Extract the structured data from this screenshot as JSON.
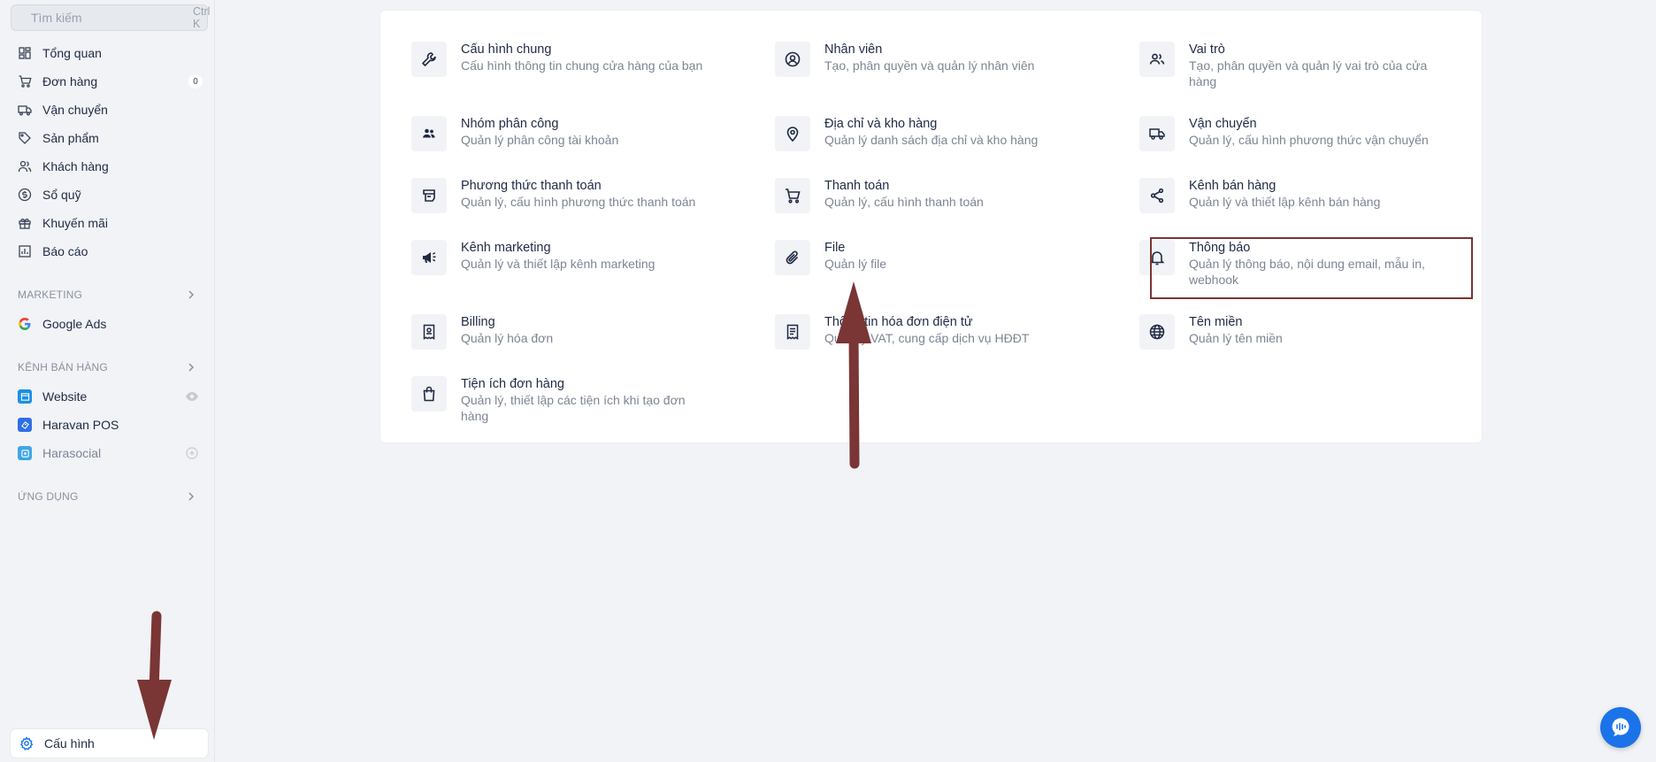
{
  "search": {
    "placeholder": "Tìm kiếm",
    "shortcut": "Ctrl K"
  },
  "nav": {
    "items": [
      {
        "label": "Tổng quan",
        "icon": "dashboard-icon"
      },
      {
        "label": "Đơn hàng",
        "icon": "cart-icon",
        "badge": "0"
      },
      {
        "label": "Vận chuyển",
        "icon": "truck-icon"
      },
      {
        "label": "Sản phẩm",
        "icon": "tag-icon"
      },
      {
        "label": "Khách hàng",
        "icon": "users-icon"
      },
      {
        "label": "Sổ quỹ",
        "icon": "dollar-icon"
      },
      {
        "label": "Khuyến mãi",
        "icon": "gift-icon"
      },
      {
        "label": "Báo cáo",
        "icon": "chart-icon"
      }
    ]
  },
  "sections": {
    "marketing": "MARKETING",
    "sales_channels": "KÊNH BÁN HÀNG",
    "apps": "ỨNG DỤNG"
  },
  "marketing_items": [
    {
      "label": "Google Ads",
      "icon": "google-icon"
    }
  ],
  "channel_items": [
    {
      "label": "Website",
      "icon": "website-icon"
    },
    {
      "label": "Haravan POS",
      "icon": "pos-icon"
    },
    {
      "label": "Harasocial",
      "icon": "harasocial-icon"
    }
  ],
  "settings_nav": {
    "label": "Cấu hình",
    "icon": "gear-icon"
  },
  "settings_tiles": [
    {
      "title": "Cấu hình chung",
      "desc": "Cấu hình thông tin chung cửa hàng của bạn",
      "icon": "wrench-icon"
    },
    {
      "title": "Nhân viên",
      "desc": "Tạo, phân quyền và quản lý nhân viên",
      "icon": "user-circle-icon"
    },
    {
      "title": "Vai trò",
      "desc": "Tạo, phân quyền và quản lý vai trò của cửa hàng",
      "icon": "users-icon"
    },
    {
      "title": "Nhóm phân công",
      "desc": "Quản lý phân công tài khoản",
      "icon": "group-icon"
    },
    {
      "title": "Địa chỉ và kho hàng",
      "desc": "Quản lý danh sách địa chỉ và kho hàng",
      "icon": "location-pin-icon"
    },
    {
      "title": "Vận chuyển",
      "desc": "Quản lý, cấu hình phương thức vận chuyển",
      "icon": "truck-icon"
    },
    {
      "title": "Phương thức thanh toán",
      "desc": "Quản lý, cấu hình phương thức thanh toán",
      "icon": "payment-icon"
    },
    {
      "title": "Thanh toán",
      "desc": "Quản lý, cấu hình thanh toán",
      "icon": "cart-icon"
    },
    {
      "title": "Kênh bán hàng",
      "desc": "Quản lý và thiết lập kênh bán hàng",
      "icon": "share-icon"
    },
    {
      "title": "Kênh marketing",
      "desc": "Quản lý và thiết lập kênh marketing",
      "icon": "megaphone-icon"
    },
    {
      "title": "File",
      "desc": "Quản lý file",
      "icon": "paperclip-icon"
    },
    {
      "title": "Thông báo",
      "desc": "Quản lý thông báo, nội dung email, mẫu in, webhook",
      "icon": "bell-icon"
    },
    {
      "title": "Billing",
      "desc": "Quản lý hóa đơn",
      "icon": "receipt-icon"
    },
    {
      "title": "Thông tin hóa đơn điện tử",
      "desc": "Quản lý VAT, cung cấp dịch vụ HĐĐT",
      "icon": "invoice-icon"
    },
    {
      "title": "Tên miền",
      "desc": "Quản lý tên miền",
      "icon": "globe-icon"
    },
    {
      "title": "Tiện ích đơn hàng",
      "desc": "Quản lý, thiết lập các tiện ích khi tạo đơn hàng",
      "icon": "bag-icon"
    }
  ],
  "colors": {
    "accent": "#1a73e8",
    "annotation": "#7a3535",
    "text": "#1f2a44",
    "muted": "#7d8594"
  }
}
